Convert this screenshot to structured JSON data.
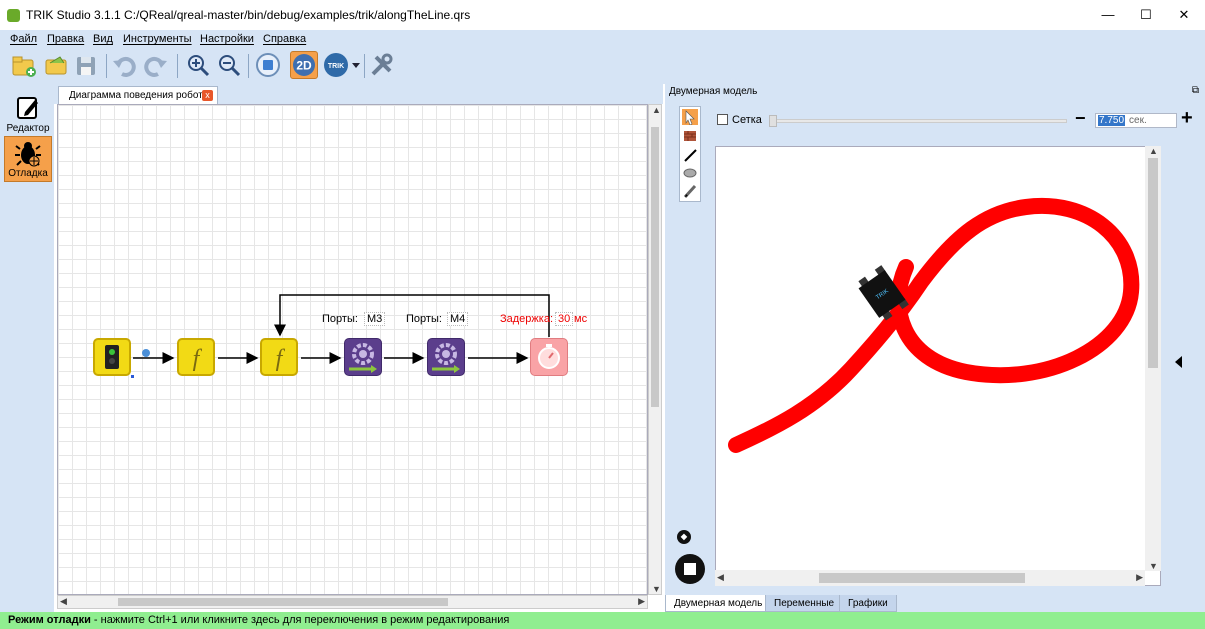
{
  "window": {
    "title": "TRIK Studio 3.1.1 C:/QReal/qreal-master/bin/debug/examples/trik/alongTheLine.qrs",
    "minimize": "—",
    "maximize": "☐",
    "close": "✕"
  },
  "menu": [
    "Файл",
    "Правка",
    "Вид",
    "Инструменты",
    "Настройки",
    "Справка"
  ],
  "toolbar": {
    "icons": [
      "new-project",
      "open",
      "save",
      "undo",
      "redo",
      "zoom-in",
      "zoom-out",
      "stop",
      "2d-model",
      "trik-robot",
      "settings"
    ],
    "mode_2d_label": "2D",
    "trik_label": "TRIK"
  },
  "modes": {
    "editor_label": "Редактор",
    "debug_label": "Отладка"
  },
  "editor": {
    "tab_label": "Диаграмма поведения робота",
    "tab_close": "x",
    "blocks": {
      "motor1_ports_label": "Порты:",
      "motor1_ports_value": "M3",
      "motor2_ports_label": "Порты:",
      "motor2_ports_value": "M4",
      "timer_label": "Задержка:",
      "timer_value": "30",
      "timer_unit": "мс"
    },
    "function_glyph": "f"
  },
  "model2d": {
    "panel_title": "Двумерная модель",
    "undock_icon": "⧉",
    "grid_label": "Сетка",
    "grid_checked": false,
    "zoom_out": "−",
    "zoom_in": "+",
    "time_value": "7.750",
    "time_unit": "сек.",
    "robot_label": "TRIK",
    "line_color": "#ff0000"
  },
  "bottom_tabs": [
    "Двумерная модель",
    "Переменные",
    "Графики"
  ],
  "status": {
    "bold": "Режим отладки",
    "text": " - нажмите Ctrl+1 или кликните здесь для переключения в режим редактирования"
  }
}
